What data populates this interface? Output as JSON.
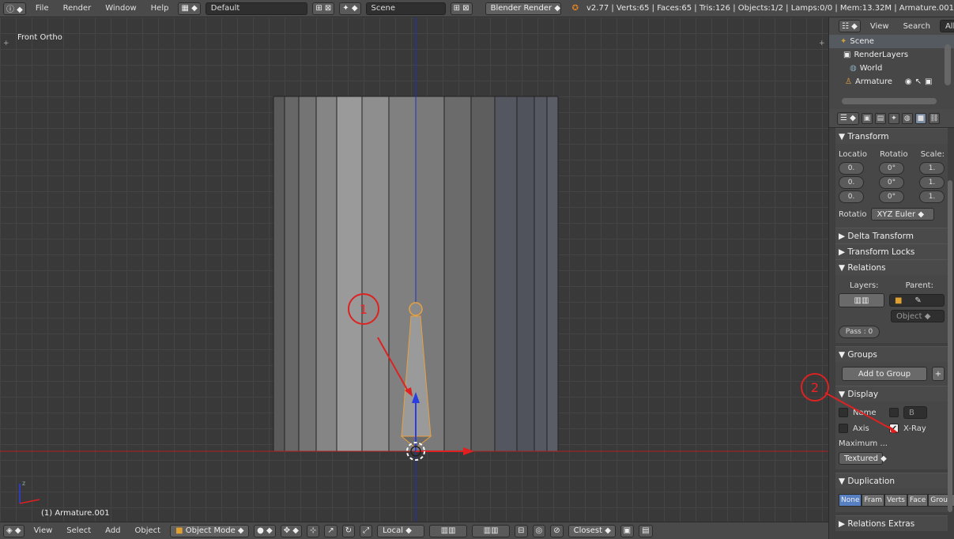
{
  "topbar": {
    "menus": [
      "File",
      "Render",
      "Window",
      "Help"
    ],
    "layout": "Default",
    "scene": "Scene",
    "engine": "Blender Render",
    "stats": "v2.77 | Verts:65 | Faces:65 | Tris:126 | Objects:1/2 | Lamps:0/0 | Mem:13.32M | Armature.001"
  },
  "viewport": {
    "title": "Front Ortho",
    "object_label": "(1) Armature.001"
  },
  "bottombar": {
    "menus": [
      "View",
      "Select",
      "Add",
      "Object"
    ],
    "mode": "Object Mode",
    "orientation": "Local",
    "snap": "Closest"
  },
  "outliner": {
    "view": "View",
    "search": "Search",
    "filter": "All Sc",
    "items": [
      "Scene",
      "RenderLayers",
      "World",
      "Armature"
    ]
  },
  "properties": {
    "transform": {
      "title": "Transform",
      "col_location": "Locatio",
      "col_rotation": "Rotatio",
      "col_scale": "Scale:",
      "loc": [
        "0.",
        "0.",
        "0."
      ],
      "rot": [
        "0°",
        "0°",
        "0°"
      ],
      "scale": [
        "1.",
        "1.",
        "1."
      ],
      "rot_mode_label": "Rotatio",
      "rot_mode": "XYZ Euler"
    },
    "delta_transform": "Delta Transform",
    "transform_locks": "Transform Locks",
    "relations": {
      "title": "Relations",
      "layers": "Layers:",
      "parent": "Parent:",
      "parent_type": "Object",
      "pass": "Pass : 0"
    },
    "groups": {
      "title": "Groups",
      "add": "Add to Group"
    },
    "display": {
      "title": "Display",
      "name": "Name",
      "b": "B",
      "axis": "Axis",
      "xray": "X-Ray",
      "xray_checked": "✔",
      "maximum": "Maximum ...",
      "textured": "Textured"
    },
    "duplication": {
      "title": "Duplication",
      "options": [
        "None",
        "Fram",
        "Verts",
        "Face",
        "Group"
      ]
    },
    "relations_extras": "Relations Extras"
  },
  "annotations": [
    "1",
    "2"
  ],
  "colors": {
    "accent": "#5680c2",
    "annotation": "#dd2222",
    "x_axis": "#cc2020",
    "z_axis": "#2030c0",
    "bone_outline": "#e8a040"
  }
}
